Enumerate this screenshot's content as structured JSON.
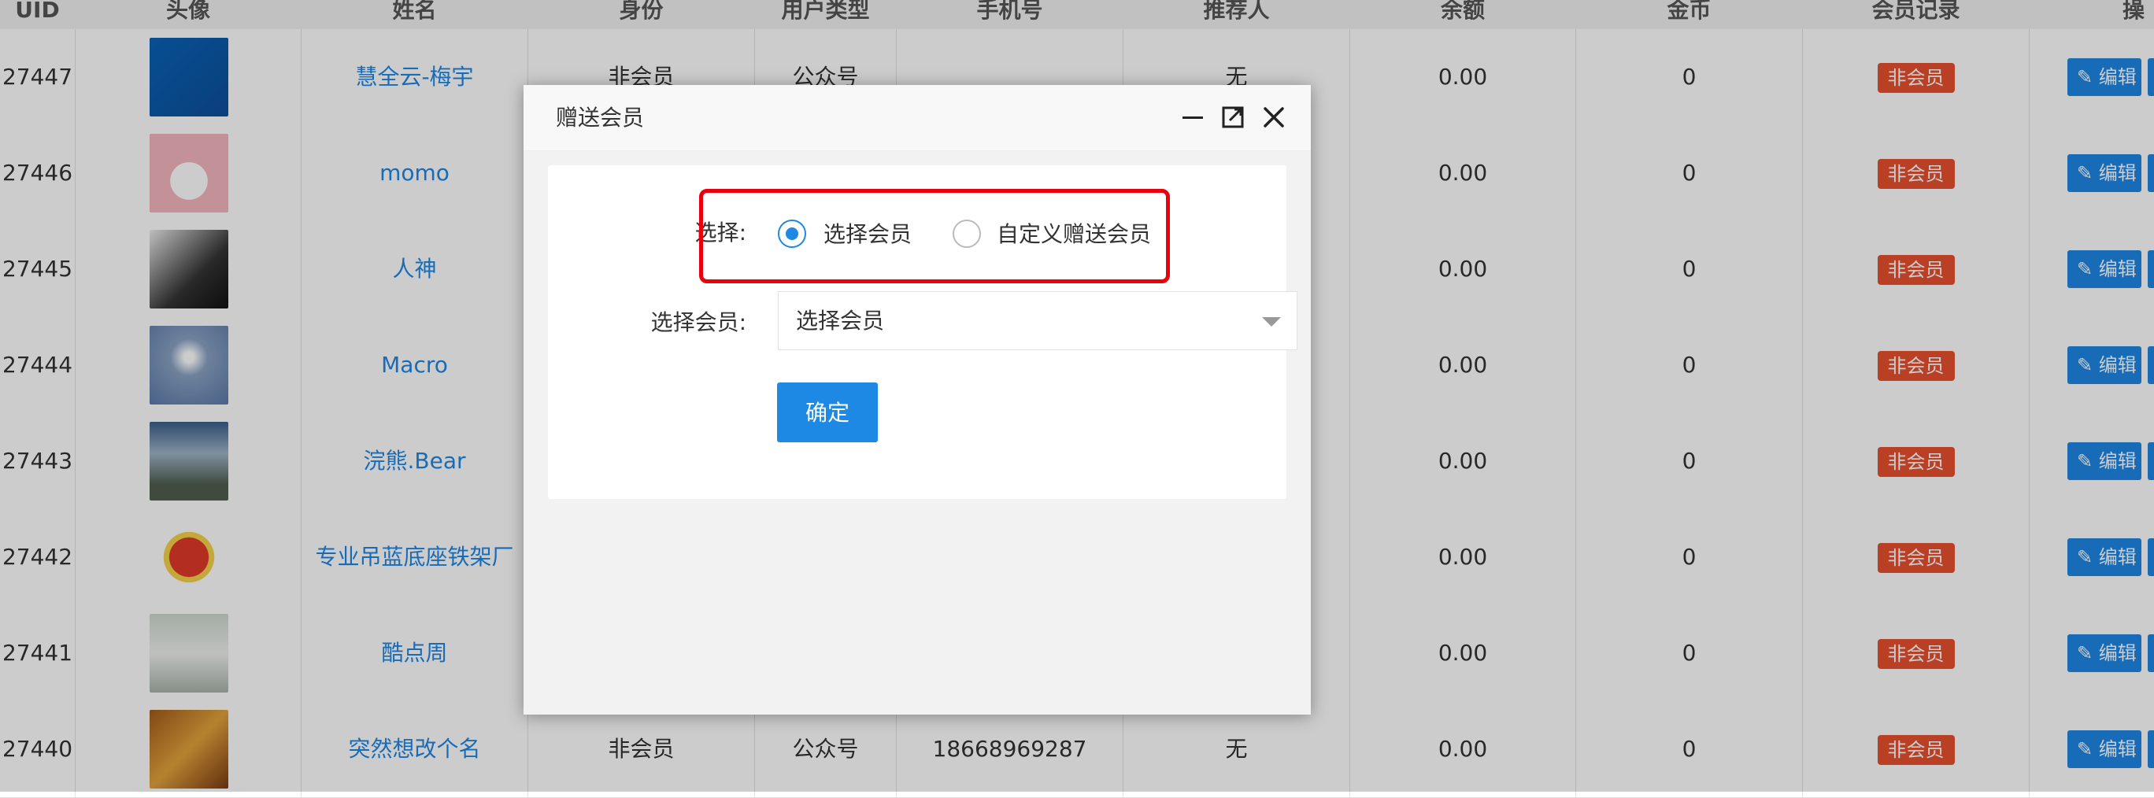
{
  "table": {
    "headers": [
      "UID",
      "头像",
      "姓名",
      "身份",
      "用户类型",
      "手机号",
      "推荐人",
      "余额",
      "金币",
      "会员记录",
      "操"
    ],
    "rows": [
      {
        "uid": "27447",
        "name": "慧全云-梅宇",
        "identity": "非会员",
        "user_type": "公众号",
        "phone": "",
        "referrer": "无",
        "balance": "0.00",
        "coins": "0",
        "record": "非会员",
        "action": "编辑"
      },
      {
        "uid": "27446",
        "name": "momo",
        "identity": "",
        "user_type": "",
        "phone": "",
        "referrer": "",
        "balance": "0.00",
        "coins": "0",
        "record": "非会员",
        "action": "编辑"
      },
      {
        "uid": "27445",
        "name": "人神",
        "identity": "",
        "user_type": "",
        "phone": "",
        "referrer": "",
        "balance": "0.00",
        "coins": "0",
        "record": "非会员",
        "action": "编辑"
      },
      {
        "uid": "27444",
        "name": "Macro",
        "identity": "",
        "user_type": "",
        "phone": "",
        "referrer": "",
        "balance": "0.00",
        "coins": "0",
        "record": "非会员",
        "action": "编辑"
      },
      {
        "uid": "27443",
        "name": "浣熊.Bear",
        "identity": "",
        "user_type": "",
        "phone": "",
        "referrer": "",
        "balance": "0.00",
        "coins": "0",
        "record": "非会员",
        "action": "编辑"
      },
      {
        "uid": "27442",
        "name": "专业吊蓝底座铁架厂",
        "identity": "",
        "user_type": "",
        "phone": "",
        "referrer": "",
        "balance": "0.00",
        "coins": "0",
        "record": "非会员",
        "action": "编辑"
      },
      {
        "uid": "27441",
        "name": "酷点周",
        "identity": "",
        "user_type": "",
        "phone": "",
        "referrer": "",
        "balance": "0.00",
        "coins": "0",
        "record": "非会员",
        "action": "编辑"
      },
      {
        "uid": "27440",
        "name": "突然想改个名",
        "identity": "非会员",
        "user_type": "公众号",
        "phone": "18668969287",
        "referrer": "无",
        "balance": "0.00",
        "coins": "0",
        "record": "非会员",
        "action": "编辑"
      }
    ]
  },
  "modal": {
    "title": "赠送会员",
    "select_label": "选择:",
    "radio_options": [
      {
        "label": "选择会员",
        "checked": true
      },
      {
        "label": "自定义赠送会员",
        "checked": false
      }
    ],
    "member_label": "选择会员:",
    "member_select_value": "选择会员",
    "confirm_label": "确定"
  },
  "colors": {
    "primary": "#1e88e5",
    "badge": "#e8502f",
    "highlight": "#e8000c"
  },
  "icons": {
    "minimize": "minimize-icon",
    "maximize": "maximize-icon",
    "close": "close-icon",
    "edit": "pencil-icon"
  }
}
